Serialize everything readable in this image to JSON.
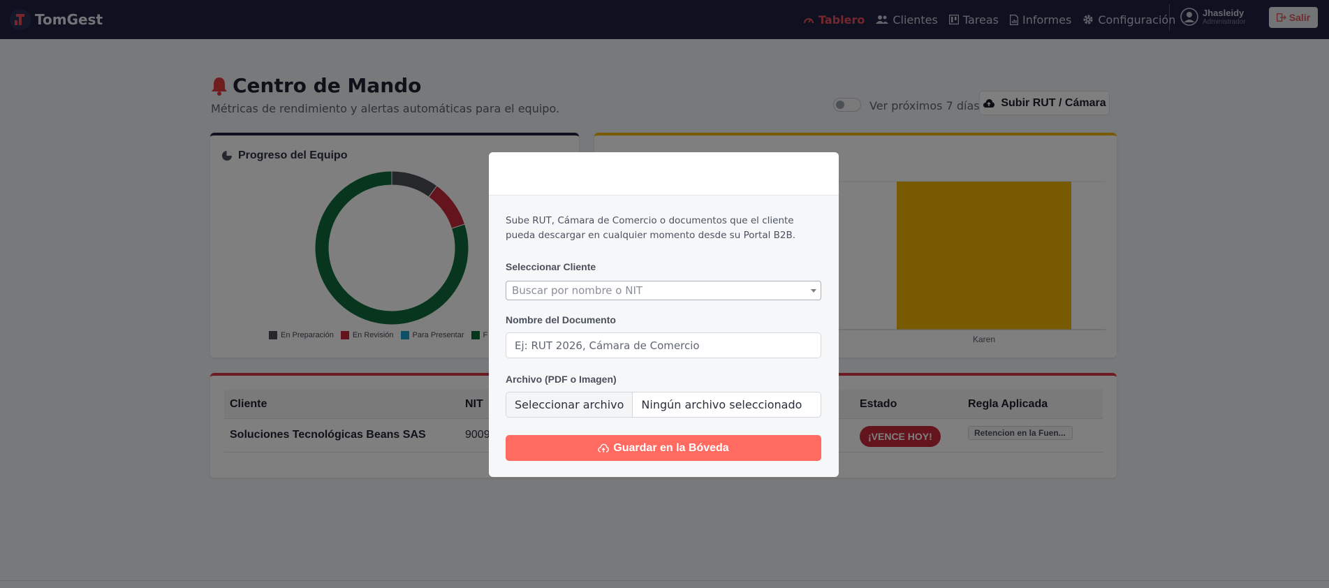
{
  "app": {
    "brand": "TomGest"
  },
  "nav": {
    "items": [
      {
        "label": "Tablero",
        "icon": "gauge-icon",
        "active": true
      },
      {
        "label": "Clientes",
        "icon": "users-icon",
        "active": false
      },
      {
        "label": "Tareas",
        "icon": "kanban-icon",
        "active": false
      },
      {
        "label": "Informes",
        "icon": "report-icon",
        "active": false
      },
      {
        "label": "Configuración",
        "icon": "gear-icon",
        "active": false
      }
    ],
    "user": {
      "name": "Jhasleidy",
      "role": "Administrador"
    },
    "logout_label": "Salir"
  },
  "page": {
    "title": "Centro de Mando",
    "subtitle": "Métricas de rendimiento y alertas automáticas para el equipo.",
    "toggle_label": "Ver próximos 7 días",
    "toggle_on": false,
    "upload_button": "Subir RUT / Cámara"
  },
  "team_card": {
    "title": "Progreso del Equipo",
    "legend": [
      {
        "label": "En Preparación",
        "color": "#4b4f57"
      },
      {
        "label": "En Revisión",
        "color": "#c8293a"
      },
      {
        "label": "Para Presentar",
        "color": "#1aa3c8"
      },
      {
        "label": "F",
        "color": "#0f6b3a"
      }
    ]
  },
  "chart_data": {
    "type": "pie",
    "series": [
      {
        "name": "En Preparación",
        "value": 1
      },
      {
        "name": "En Revisión",
        "value": 1
      },
      {
        "name": "Para Presentar",
        "value": 0
      },
      {
        "name": "F",
        "value": 8
      }
    ],
    "colors": [
      "#4b4f57",
      "#c8293a",
      "#1aa3c8",
      "#0f6b3a"
    ]
  },
  "load_card": {
    "title": "",
    "categories": [
      "Karen"
    ],
    "bar_color": "#f0b400"
  },
  "table": {
    "headers": [
      "Cliente",
      "NIT",
      "Estado",
      "Regla Aplicada"
    ],
    "rows": [
      {
        "client": "Soluciones Tecnológicas Beans SAS",
        "nit": "9009",
        "status": "¡VENCE HOY!",
        "rule": "Retencion en la Fuen..."
      }
    ]
  },
  "modal": {
    "description": "Sube RUT, Cámara de Comercio o documentos que el cliente pueda descargar en cualquier momento desde su Portal B2B.",
    "client_label": "Seleccionar Cliente",
    "client_placeholder": "Buscar por nombre o NIT",
    "doc_label": "Nombre del Documento",
    "doc_placeholder": "Ej: RUT 2026, Cámara de Comercio",
    "file_label": "Archivo (PDF o Imagen)",
    "file_button": "Seleccionar archivo",
    "file_status": "Ningún archivo seleccionado",
    "save_button": "Guardar en la Bóveda"
  }
}
